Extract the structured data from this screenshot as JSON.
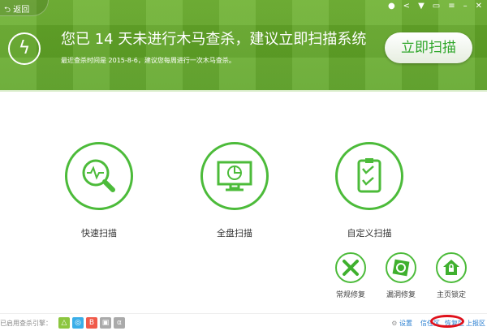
{
  "header": {
    "back_label": "返回",
    "title": "您已 14 天未进行木马查杀，建议立即扫描系统",
    "subtitle": "最近查杀时间是 2015-8-6，建议您每周进行一次木马查杀。",
    "scan_button": "立即扫描",
    "top_icons": [
      "medal-icon",
      "share-icon",
      "skin-icon",
      "message-icon",
      "menu-icon",
      "minimize-icon",
      "close-icon"
    ]
  },
  "scans": [
    {
      "label": "快速扫描",
      "icon": "quick-scan-icon"
    },
    {
      "label": "全盘扫描",
      "icon": "full-scan-icon"
    },
    {
      "label": "自定义扫描",
      "icon": "custom-scan-icon"
    }
  ],
  "repairs": [
    {
      "label": "常规修复",
      "icon": "wrench-icon"
    },
    {
      "label": "漏洞修复",
      "icon": "vulnerability-icon"
    },
    {
      "label": "主页锁定",
      "icon": "home-lock-icon"
    }
  ],
  "footer": {
    "engines_label": "已启用查杀引擎：",
    "engines": [
      {
        "color": "#8cc63f"
      },
      {
        "color": "#3aaee8"
      },
      {
        "color": "#f05a4a"
      },
      {
        "color": "#aaaaaa"
      },
      {
        "color": "#aaaaaa"
      }
    ],
    "settings": "设置",
    "trust": "信任区",
    "restore": "恢复区",
    "report": "上报区"
  },
  "colors": {
    "accent": "#4cbb3a",
    "highlight": "#e0101a"
  }
}
